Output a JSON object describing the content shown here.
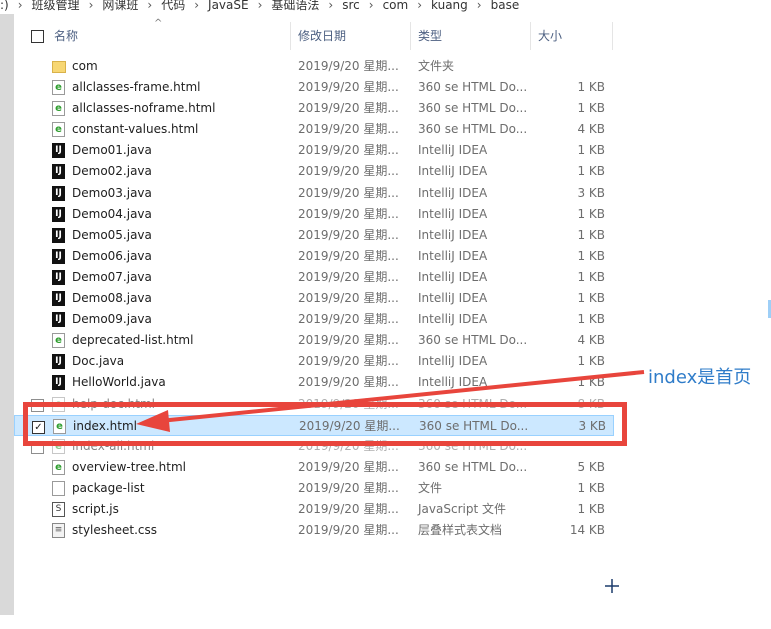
{
  "breadcrumb": [
    ":)",
    "班级管理",
    "网课班",
    "代码",
    "JavaSE",
    "基础语法",
    "src",
    "com",
    "kuang",
    "base"
  ],
  "columns": {
    "name": "名称",
    "modified": "修改日期",
    "type": "类型",
    "size": "大小"
  },
  "sort_indicator": "^",
  "files": [
    {
      "name": "com",
      "date": "2019/9/20 星期...",
      "type": "文件夹",
      "size": "",
      "icon": "folder-icon"
    },
    {
      "name": "allclasses-frame.html",
      "date": "2019/9/20 星期...",
      "type": "360 se HTML Do...",
      "size": "1 KB",
      "icon": "html-file-icon"
    },
    {
      "name": "allclasses-noframe.html",
      "date": "2019/9/20 星期...",
      "type": "360 se HTML Do...",
      "size": "1 KB",
      "icon": "html-file-icon"
    },
    {
      "name": "constant-values.html",
      "date": "2019/9/20 星期...",
      "type": "360 se HTML Do...",
      "size": "4 KB",
      "icon": "html-file-icon"
    },
    {
      "name": "Demo01.java",
      "date": "2019/9/20 星期...",
      "type": "IntelliJ IDEA",
      "size": "1 KB",
      "icon": "intellij-file-icon"
    },
    {
      "name": "Demo02.java",
      "date": "2019/9/20 星期...",
      "type": "IntelliJ IDEA",
      "size": "1 KB",
      "icon": "intellij-file-icon"
    },
    {
      "name": "Demo03.java",
      "date": "2019/9/20 星期...",
      "type": "IntelliJ IDEA",
      "size": "3 KB",
      "icon": "intellij-file-icon"
    },
    {
      "name": "Demo04.java",
      "date": "2019/9/20 星期...",
      "type": "IntelliJ IDEA",
      "size": "1 KB",
      "icon": "intellij-file-icon"
    },
    {
      "name": "Demo05.java",
      "date": "2019/9/20 星期...",
      "type": "IntelliJ IDEA",
      "size": "1 KB",
      "icon": "intellij-file-icon"
    },
    {
      "name": "Demo06.java",
      "date": "2019/9/20 星期...",
      "type": "IntelliJ IDEA",
      "size": "1 KB",
      "icon": "intellij-file-icon"
    },
    {
      "name": "Demo07.java",
      "date": "2019/9/20 星期...",
      "type": "IntelliJ IDEA",
      "size": "1 KB",
      "icon": "intellij-file-icon"
    },
    {
      "name": "Demo08.java",
      "date": "2019/9/20 星期...",
      "type": "IntelliJ IDEA",
      "size": "1 KB",
      "icon": "intellij-file-icon"
    },
    {
      "name": "Demo09.java",
      "date": "2019/9/20 星期...",
      "type": "IntelliJ IDEA",
      "size": "1 KB",
      "icon": "intellij-file-icon"
    },
    {
      "name": "deprecated-list.html",
      "date": "2019/9/20 星期...",
      "type": "360 se HTML Do...",
      "size": "4 KB",
      "icon": "html-file-icon"
    },
    {
      "name": "Doc.java",
      "date": "2019/9/20 星期...",
      "type": "IntelliJ IDEA",
      "size": "1 KB",
      "icon": "intellij-file-icon"
    },
    {
      "name": "HelloWorld.java",
      "date": "2019/9/20 星期...",
      "type": "IntelliJ IDEA",
      "size": "1 KB",
      "icon": "intellij-file-icon"
    },
    {
      "name": "help-doc.html",
      "date": "2019/9/20 星期...",
      "type": "360 se HTML Do...",
      "size": "8 KB",
      "icon": "html-file-icon",
      "obscured": true
    },
    {
      "name": "index.html",
      "date": "2019/9/20 星期...",
      "type": "360 se HTML Do...",
      "size": "3 KB",
      "icon": "html-file-icon",
      "selected": true,
      "checked": true
    },
    {
      "name": "index-all.html",
      "date": "2019/9/20 星期...",
      "type": "360 se HTML Do...",
      "size": "",
      "icon": "html-file-icon",
      "obscured": true
    },
    {
      "name": "overview-tree.html",
      "date": "2019/9/20 星期...",
      "type": "360 se HTML Do...",
      "size": "5 KB",
      "icon": "html-file-icon"
    },
    {
      "name": "package-list",
      "date": "2019/9/20 星期...",
      "type": "文件",
      "size": "1 KB",
      "icon": "generic-file-icon"
    },
    {
      "name": "script.js",
      "date": "2019/9/20 星期...",
      "type": "JavaScript 文件",
      "size": "1 KB",
      "icon": "javascript-file-icon"
    },
    {
      "name": "stylesheet.css",
      "date": "2019/9/20 星期...",
      "type": "层叠样式表文档",
      "size": "14 KB",
      "icon": "css-file-icon"
    }
  ],
  "annotation": {
    "text": "index是首页",
    "color": "#2f7cc9"
  },
  "colors": {
    "highlight_box": "#e8453c",
    "selection_bg": "#cce8ff",
    "selection_border": "#99d1ff",
    "header_text": "#4d6082"
  }
}
